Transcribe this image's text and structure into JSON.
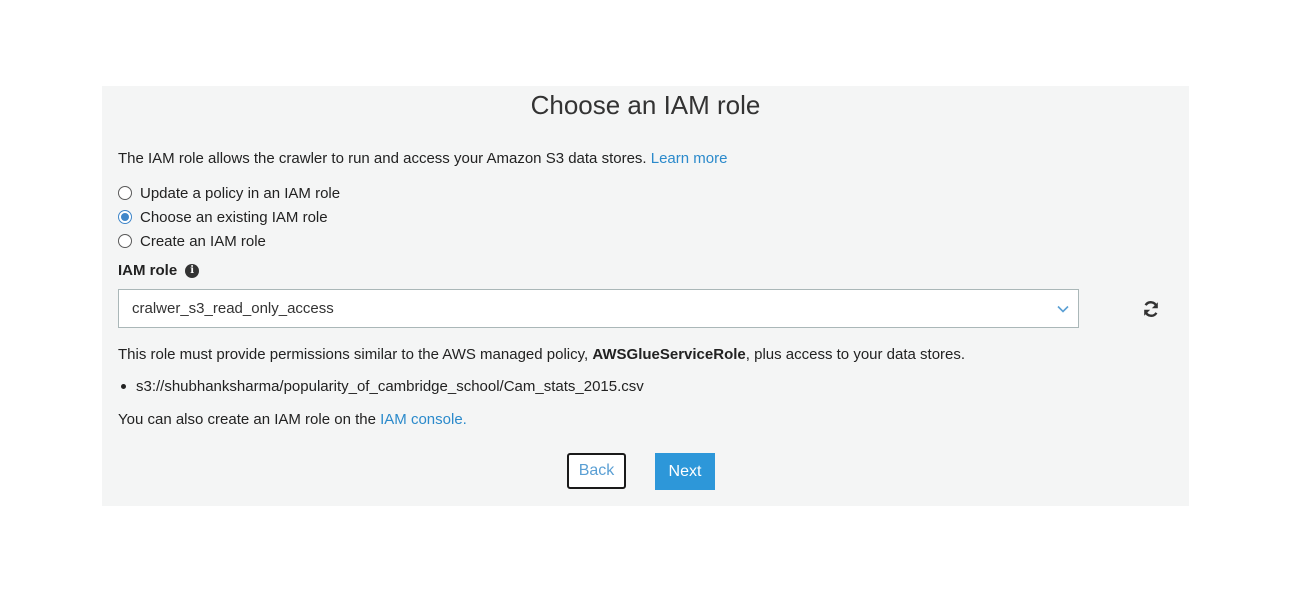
{
  "page": {
    "title": "Choose an IAM role"
  },
  "intro": {
    "text": "The IAM role allows the crawler to run and access your Amazon S3 data stores. ",
    "link": "Learn more"
  },
  "options": [
    {
      "label": "Update a policy in an IAM role",
      "selected": false
    },
    {
      "label": "Choose an existing IAM role",
      "selected": true
    },
    {
      "label": "Create an IAM role",
      "selected": false
    }
  ],
  "role_field": {
    "label": "IAM role",
    "value": "cralwer_s3_read_only_access",
    "info_icon": "info-icon",
    "chevron_icon": "chevron-down-icon",
    "refresh_icon": "refresh-icon"
  },
  "note": {
    "prefix": "This role must provide permissions similar to the AWS managed policy, ",
    "policy": "AWSGlueServiceRole",
    "suffix": ", plus access to your data stores."
  },
  "data_stores": [
    "s3://shubhanksharma/popularity_of_cambridge_school/Cam_stats_2015.csv"
  ],
  "also": {
    "text": "You can also create an IAM role on the ",
    "link": "IAM console."
  },
  "buttons": {
    "back": "Back",
    "next": "Next"
  },
  "colors": {
    "link": "#2b8acb",
    "primary_button": "#2d97d9",
    "panel_background": "#f4f5f5"
  }
}
